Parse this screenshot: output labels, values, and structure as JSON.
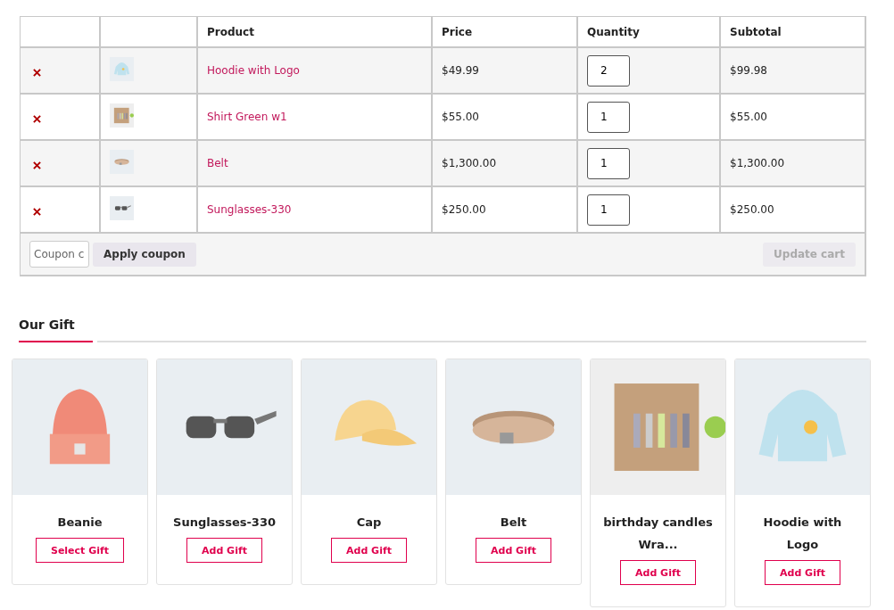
{
  "cart": {
    "columns": [
      "Product",
      "Price",
      "Quantity",
      "Subtotal"
    ],
    "rows": [
      {
        "product": "Hoodie with Logo",
        "price": "$49.99",
        "quantity": "2",
        "subtotal": "$99.98"
      },
      {
        "product": "Shirt Green w1",
        "price": "$55.00",
        "quantity": "1",
        "subtotal": "$55.00"
      },
      {
        "product": "Belt",
        "price": "$1,300.00",
        "quantity": "1",
        "subtotal": "$1,300.00"
      },
      {
        "product": "Sunglasses-330",
        "price": "$250.00",
        "quantity": "1",
        "subtotal": "$250.00"
      }
    ],
    "coupon": {
      "placeholder": "Coupon c"
    },
    "apply_button": "Apply coupon",
    "update_button": {
      "label": "Update cart",
      "disabled": true
    }
  },
  "gifts": {
    "title": "Our Gift",
    "items": [
      {
        "name": "Beanie",
        "button": "Select Gift"
      },
      {
        "name": "Sunglasses-330",
        "button": "Add Gift"
      },
      {
        "name": "Cap",
        "button": "Add Gift"
      },
      {
        "name": "Belt",
        "button": "Add Gift"
      },
      {
        "name": "birthday candles Wra...",
        "button": "Add Gift"
      },
      {
        "name": "Hoodie with Logo",
        "button": "Add Gift"
      }
    ]
  }
}
